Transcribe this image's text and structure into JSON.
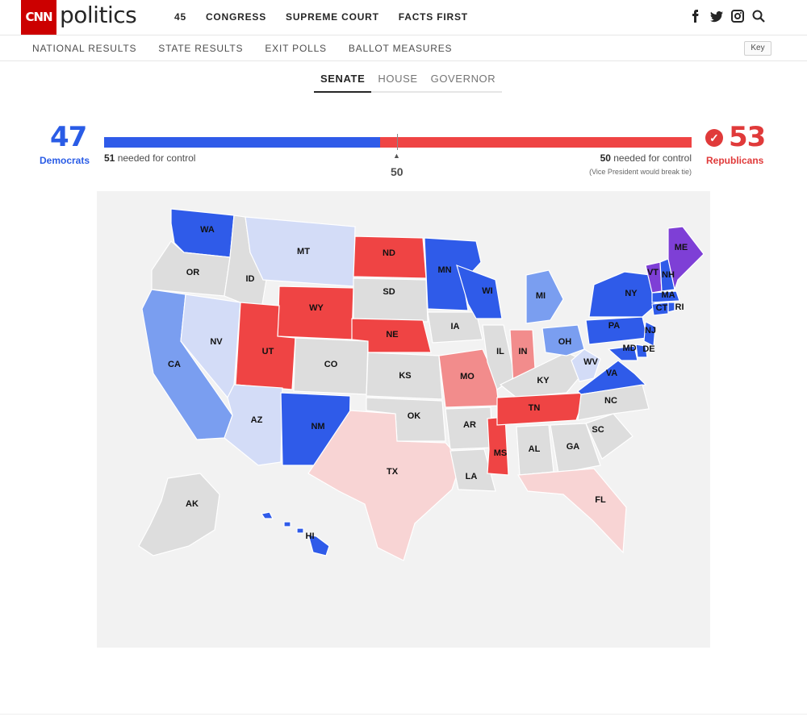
{
  "header": {
    "logo_text": "CNN",
    "brand": "politics",
    "nav": [
      "45",
      "CONGRESS",
      "SUPREME COURT",
      "FACTS FIRST"
    ],
    "social_icons": [
      "facebook-icon",
      "twitter-icon",
      "instagram-icon",
      "search-icon"
    ]
  },
  "subnav": {
    "items": [
      "NATIONAL RESULTS",
      "STATE RESULTS",
      "EXIT POLLS",
      "BALLOT MEASURES"
    ],
    "key_label": "Key"
  },
  "race_tabs": {
    "items": [
      "SENATE",
      "HOUSE",
      "GOVERNOR"
    ],
    "active": "SENATE"
  },
  "balance": {
    "dem_seats": "47",
    "dem_label": "Democrats",
    "rep_seats": "53",
    "rep_label": "Republicans",
    "dem_needed_num": "51",
    "dem_needed_text": " needed for control",
    "rep_needed_num": "50",
    "rep_needed_text": " needed for control",
    "vp_note": "(Vice President would break tie)",
    "midpoint": "50",
    "dem_share": 0.47
  },
  "colors": {
    "dem_solid": "#2f5be9",
    "dem_mid": "#7a9ef0",
    "dem_light": "#d3dcf7",
    "rep_solid": "#ef4444",
    "rep_mid": "#f28c8c",
    "rep_light": "#f8d4d4",
    "ind": "#7e3fd6",
    "none": "#dddddd"
  },
  "map": {
    "states": [
      {
        "id": "WA",
        "color": "dem_solid"
      },
      {
        "id": "OR",
        "color": "none"
      },
      {
        "id": "CA",
        "color": "dem_mid"
      },
      {
        "id": "NV",
        "color": "dem_light"
      },
      {
        "id": "ID",
        "color": "none"
      },
      {
        "id": "MT",
        "color": "dem_light"
      },
      {
        "id": "WY",
        "color": "rep_solid"
      },
      {
        "id": "UT",
        "color": "rep_solid"
      },
      {
        "id": "AZ",
        "color": "dem_light"
      },
      {
        "id": "CO",
        "color": "none"
      },
      {
        "id": "NM",
        "color": "dem_solid"
      },
      {
        "id": "ND",
        "color": "rep_solid"
      },
      {
        "id": "SD",
        "color": "none"
      },
      {
        "id": "NE",
        "color": "rep_solid"
      },
      {
        "id": "KS",
        "color": "none"
      },
      {
        "id": "OK",
        "color": "none"
      },
      {
        "id": "TX",
        "color": "rep_light"
      },
      {
        "id": "MN",
        "color": "dem_solid"
      },
      {
        "id": "IA",
        "color": "none"
      },
      {
        "id": "MO",
        "color": "rep_mid"
      },
      {
        "id": "AR",
        "color": "none"
      },
      {
        "id": "LA",
        "color": "none"
      },
      {
        "id": "WI",
        "color": "dem_solid"
      },
      {
        "id": "IL",
        "color": "none"
      },
      {
        "id": "MS",
        "color": "rep_solid"
      },
      {
        "id": "MI",
        "color": "dem_mid"
      },
      {
        "id": "IN",
        "color": "rep_mid"
      },
      {
        "id": "KY",
        "color": "none"
      },
      {
        "id": "TN",
        "color": "rep_solid"
      },
      {
        "id": "AL",
        "color": "none"
      },
      {
        "id": "OH",
        "color": "dem_mid"
      },
      {
        "id": "WV",
        "color": "dem_light"
      },
      {
        "id": "VA",
        "color": "dem_solid"
      },
      {
        "id": "NC",
        "color": "none"
      },
      {
        "id": "SC",
        "color": "none"
      },
      {
        "id": "GA",
        "color": "none"
      },
      {
        "id": "FL",
        "color": "rep_light"
      },
      {
        "id": "PA",
        "color": "dem_solid"
      },
      {
        "id": "NY",
        "color": "dem_solid"
      },
      {
        "id": "VT",
        "color": "ind"
      },
      {
        "id": "NH",
        "color": "dem_solid"
      },
      {
        "id": "ME",
        "color": "ind"
      },
      {
        "id": "MA",
        "color": "dem_solid"
      },
      {
        "id": "CT",
        "color": "dem_solid"
      },
      {
        "id": "RI",
        "color": "dem_solid"
      },
      {
        "id": "NJ",
        "color": "dem_solid"
      },
      {
        "id": "DE",
        "color": "dem_solid"
      },
      {
        "id": "MD",
        "color": "dem_solid"
      },
      {
        "id": "AK",
        "color": "none"
      },
      {
        "id": "HI",
        "color": "dem_solid"
      }
    ]
  }
}
